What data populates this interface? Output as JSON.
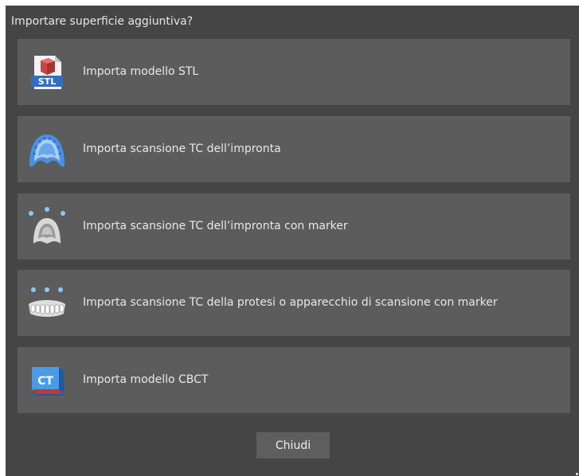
{
  "dialog": {
    "title": "Importare superficie aggiuntiva?",
    "options": [
      {
        "label": "Importa modello STL",
        "icon": "stl-file-icon",
        "icon_text": "STL"
      },
      {
        "label": "Importa scansione TC dell’impronta",
        "icon": "impression-icon"
      },
      {
        "label": "Importa scansione TC dell’impronta con marker",
        "icon": "impression-marker-icon"
      },
      {
        "label": "Importa scansione TC della protesi o apparecchio di scansione con marker",
        "icon": "prosthesis-marker-icon"
      },
      {
        "label": "Importa modello CBCT",
        "icon": "cbct-model-icon",
        "icon_text": "CT"
      }
    ],
    "close_label": "Chiudi"
  },
  "colors": {
    "background": "#454545",
    "option_background": "#5c5c5c",
    "text": "#e8e8e8",
    "accent_blue": "#3a8fd9",
    "accent_red": "#c0392b"
  }
}
